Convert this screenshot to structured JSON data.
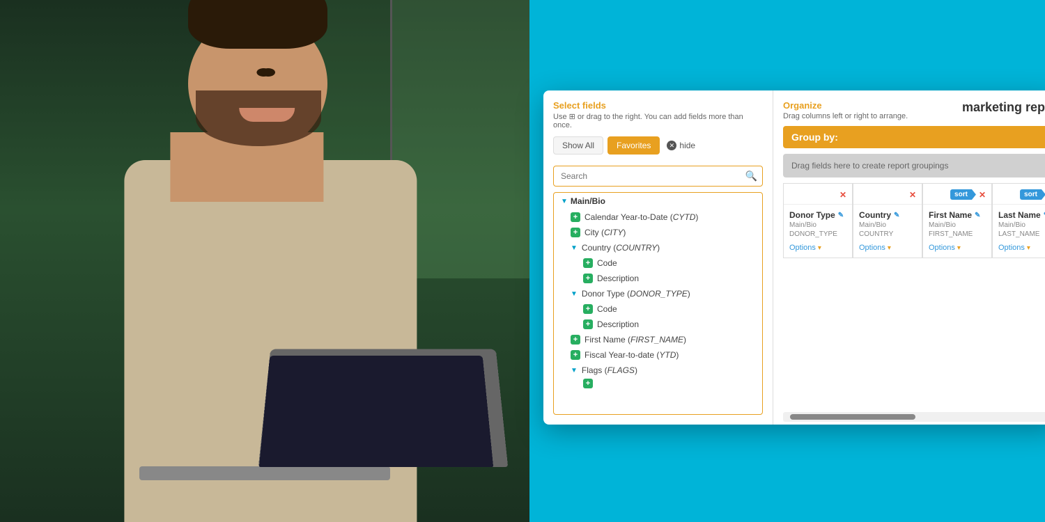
{
  "photo": {
    "alt": "Man smiling at laptop"
  },
  "modal": {
    "select_fields": {
      "title": "Select fields",
      "subtitle": "Use ⊞ or drag to the right. You can add fields more than once.",
      "tab_show_all": "Show All",
      "tab_favorites": "Favorites",
      "hide_label": "hide",
      "search_placeholder": "Search"
    },
    "organize": {
      "title": "Organize",
      "subtitle": "Drag columns left or right to arrange.",
      "report_title": "marketing report",
      "group_by_label": "Group by:",
      "group_drop_label": "Drag fields here to create report groupings"
    },
    "fields": [
      {
        "type": "group",
        "label": "Main/Bio",
        "expanded": true
      },
      {
        "type": "item",
        "label": "Calendar Year-to-Date (",
        "label_italic": "CYTD",
        "label_end": ")",
        "depth": 1
      },
      {
        "type": "item",
        "label": "City (",
        "label_italic": "CITY",
        "label_end": ")",
        "depth": 1
      },
      {
        "type": "group_child",
        "label": "Country (",
        "label_italic": "COUNTRY",
        "label_end": ")",
        "depth": 1,
        "expanded": true
      },
      {
        "type": "item",
        "label": "Code",
        "depth": 2
      },
      {
        "type": "item",
        "label": "Description",
        "depth": 2
      },
      {
        "type": "group_child",
        "label": "Donor Type (",
        "label_italic": "DONOR_TYPE",
        "label_end": ")",
        "depth": 1,
        "expanded": true
      },
      {
        "type": "item",
        "label": "Code",
        "depth": 2
      },
      {
        "type": "item",
        "label": "Description",
        "depth": 2
      },
      {
        "type": "item",
        "label": "First Name (",
        "label_italic": "FIRST_NAME",
        "label_end": ")",
        "depth": 1
      },
      {
        "type": "item",
        "label": "Fiscal Year-to-date (",
        "label_italic": "YTD",
        "label_end": ")",
        "depth": 1
      },
      {
        "type": "group_child",
        "label": "Flags (",
        "label_italic": "FLAGS",
        "label_end": ")",
        "depth": 1,
        "expanded": true
      }
    ],
    "columns": [
      {
        "id": "donor_type",
        "name": "Donor Type",
        "path": "Main/Bio",
        "db_name": "DONOR_TYPE",
        "has_sort": false,
        "options_label": "Options"
      },
      {
        "id": "country",
        "name": "Country",
        "path": "Main/Bio",
        "db_name": "COUNTRY",
        "has_sort": false,
        "options_label": "Options"
      },
      {
        "id": "first_name",
        "name": "First Name",
        "path": "Main/Bio",
        "db_name": "FIRST_NAME",
        "has_sort": true,
        "sort_label": "sort",
        "options_label": "Options"
      },
      {
        "id": "last_name",
        "name": "Last Name",
        "path": "Main/Bio",
        "db_name": "LAST_NAME",
        "has_sort": true,
        "sort_label": "sort",
        "options_label": "Options"
      }
    ]
  }
}
